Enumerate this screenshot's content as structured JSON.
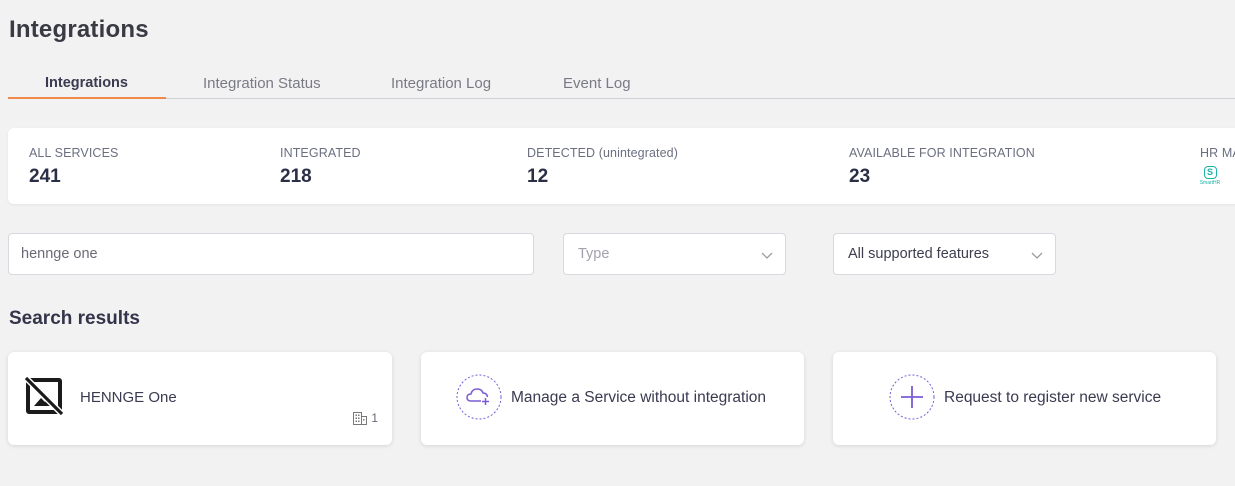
{
  "page": {
    "title": "Integrations"
  },
  "tabs": [
    {
      "label": "Integrations",
      "active": true
    },
    {
      "label": "Integration Status",
      "active": false
    },
    {
      "label": "Integration Log",
      "active": false
    },
    {
      "label": "Event Log",
      "active": false
    }
  ],
  "stats": {
    "all_services": {
      "label": "ALL SERVICES",
      "value": "241"
    },
    "integrated": {
      "label": "INTEGRATED",
      "value": "218"
    },
    "detected": {
      "label": "DETECTED (unintegrated)",
      "value": "12"
    },
    "available": {
      "label": "AVAILABLE FOR INTEGRATION",
      "value": "23"
    },
    "hr_master": {
      "label": "HR MA",
      "logo_icon": "smarthr-logo",
      "logo_letter": "S",
      "logo_text": "SmartHR"
    }
  },
  "filters": {
    "search_value": "hennge one",
    "type_placeholder": "Type",
    "features_value": "All supported features"
  },
  "results": {
    "title": "Search results",
    "items": [
      {
        "name": "HENNGE One",
        "count": "1",
        "icon": "no-image-icon"
      }
    ],
    "manage_label": "Manage a Service without integration",
    "request_label": "Request to register new service"
  },
  "colors": {
    "accent": "#f08a4b",
    "purple": "#7b5cd6",
    "teal": "#1bb3a6"
  }
}
